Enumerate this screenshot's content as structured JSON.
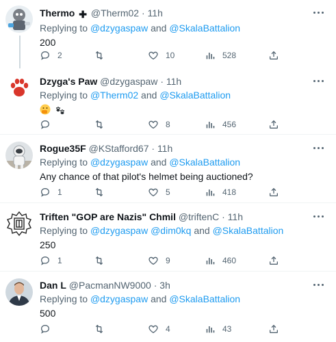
{
  "colors": {
    "accent": "#1d9bf0",
    "muted": "#536471",
    "text": "#0f1419",
    "divider": "#eff3f4"
  },
  "tweets": [
    {
      "name": "Thermo",
      "verified_mark": "✚",
      "handle": "@Therm02",
      "sep": "·",
      "time": "11h",
      "reply_prefix": "Replying to ",
      "mentions": [
        "@dzygaspaw",
        "@SkalaBattalion"
      ],
      "connectors": [
        " and "
      ],
      "text": "200",
      "counts": {
        "replies": "2",
        "retweets": "",
        "likes": "10",
        "views": "528"
      },
      "avatar_icon": "cartoon-character-avatar"
    },
    {
      "name": "Dzyga's Paw",
      "handle": "@dzygaspaw",
      "sep": "·",
      "time": "11h",
      "reply_prefix": "Replying to ",
      "mentions": [
        "@Therm02",
        "@SkalaBattalion"
      ],
      "connectors": [
        " and "
      ],
      "emojis": [
        "smiling-face-with-hand-over-mouth-emoji",
        "paw-prints-emoji"
      ],
      "counts": {
        "replies": "",
        "retweets": "",
        "likes": "8",
        "views": "456"
      },
      "avatar_icon": "paw-logo-avatar"
    },
    {
      "name": "Rogue35F",
      "handle": "@KStafford67",
      "sep": "·",
      "time": "11h",
      "reply_prefix": "Replying to ",
      "mentions": [
        "@dzygaspaw",
        "@SkalaBattalion"
      ],
      "connectors": [
        " and "
      ],
      "text": "Any chance of that pilot's helmet being auctioned?",
      "counts": {
        "replies": "1",
        "retweets": "",
        "likes": "5",
        "views": "418"
      },
      "avatar_icon": "astronaut-avatar"
    },
    {
      "name": "Triften \"GOP are Nazis\" Chmil",
      "handle": "@triftenC",
      "sep": "·",
      "time": "11h",
      "reply_prefix": "Replying to ",
      "mentions": [
        "@dzygaspaw",
        "@dim0kq",
        "@SkalaBattalion"
      ],
      "connectors": [
        " ",
        " and "
      ],
      "text": "250",
      "counts": {
        "replies": "1",
        "retweets": "",
        "likes": "9",
        "views": "460"
      },
      "avatar_icon": "emblem-avatar"
    },
    {
      "name": "Dan L",
      "handle": "@PacmanNW9000",
      "sep": "·",
      "time": "3h",
      "reply_prefix": "Replying to ",
      "mentions": [
        "@dzygaspaw",
        "@SkalaBattalion"
      ],
      "connectors": [
        " and "
      ],
      "text": "500",
      "counts": {
        "replies": "",
        "retweets": "",
        "likes": "4",
        "views": "43"
      },
      "avatar_icon": "profile-photo-avatar"
    }
  ]
}
